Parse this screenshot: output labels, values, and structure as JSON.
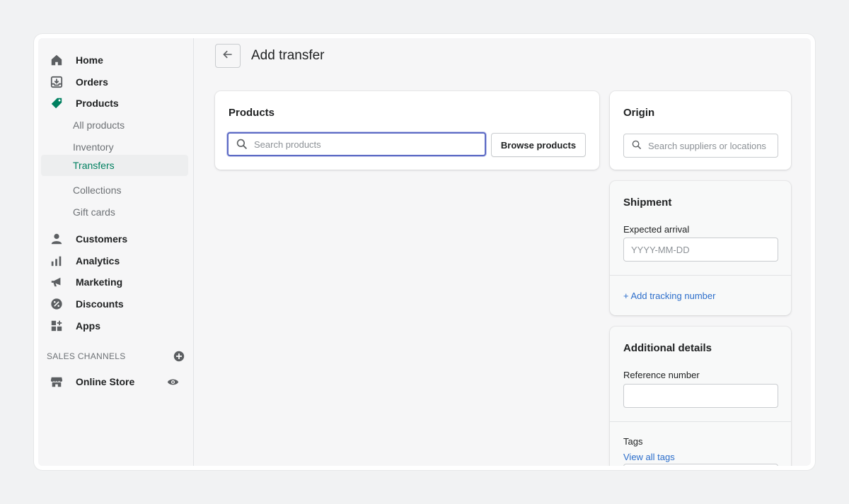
{
  "sidebar": {
    "items": [
      {
        "label": "Home",
        "icon": "home-icon"
      },
      {
        "label": "Orders",
        "icon": "orders-icon"
      },
      {
        "label": "Products",
        "icon": "tag-icon"
      }
    ],
    "sub_items": [
      {
        "label": "All products"
      },
      {
        "label": "Inventory"
      },
      {
        "label": "Transfers",
        "active": true
      },
      {
        "label": "Collections"
      },
      {
        "label": "Gift cards"
      }
    ],
    "items2": [
      {
        "label": "Customers",
        "icon": "person-icon"
      },
      {
        "label": "Analytics",
        "icon": "bar-chart-icon"
      },
      {
        "label": "Marketing",
        "icon": "megaphone-icon"
      },
      {
        "label": "Discounts",
        "icon": "discount-icon"
      },
      {
        "label": "Apps",
        "icon": "apps-icon"
      }
    ],
    "sales_channels_heading": "SALES CHANNELS",
    "online_store": "Online Store"
  },
  "header": {
    "title": "Add transfer"
  },
  "products_card": {
    "title": "Products",
    "search_placeholder": "Search products",
    "browse_label": "Browse products"
  },
  "origin_card": {
    "title": "Origin",
    "search_placeholder": "Search suppliers or locations"
  },
  "shipment_card": {
    "title": "Shipment",
    "expected_arrival_label": "Expected arrival",
    "date_placeholder": "YYYY-MM-DD",
    "add_tracking": "+ Add tracking number"
  },
  "details_card": {
    "title": "Additional details",
    "reference_label": "Reference number",
    "reference_value": "",
    "tags_label": "Tags",
    "view_all_tags": "View all tags"
  },
  "colors": {
    "accent_green": "#008060",
    "link_blue": "#2c6ecb",
    "focus_blue": "#5c6ac4"
  }
}
